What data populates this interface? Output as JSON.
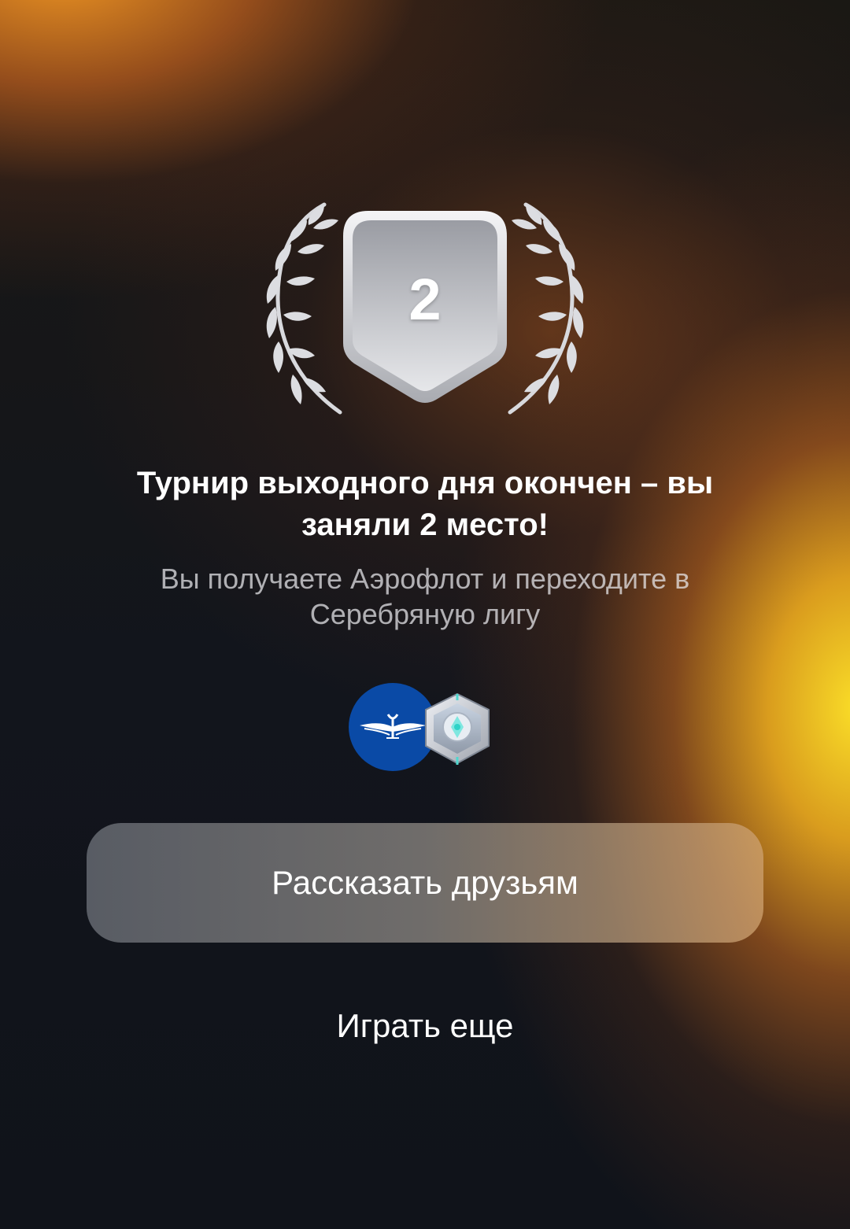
{
  "result": {
    "place": "2",
    "title": "Турнир выходного дня окончен – вы заняли 2 место!",
    "subtitle": "Вы получаете Аэрофлот и переходите в Серебряную лигу"
  },
  "rewards": {
    "airline_icon": "aeroflot-logo",
    "league_icon": "silver-league-badge"
  },
  "actions": {
    "share_label": "Рассказать друзьям",
    "play_again_label": "Играть еще"
  },
  "colors": {
    "accent_yellow": "#FFE228",
    "accent_orange": "#F0962A",
    "background": "#11141B",
    "aeroflot_blue": "#0A4AA6",
    "badge_silver": "#C9CCD2"
  }
}
